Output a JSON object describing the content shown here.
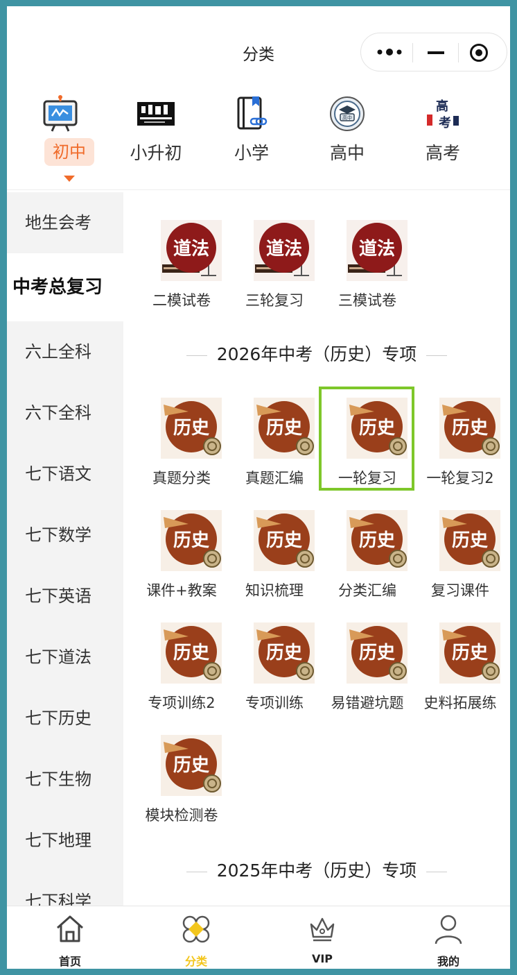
{
  "header": {
    "title": "分类"
  },
  "capsule": {
    "more": "more-dots-icon",
    "minimize": "minimize-icon",
    "close": "target-icon"
  },
  "top_categories": [
    {
      "label": "初中",
      "active": true,
      "icon": "board-icon"
    },
    {
      "label": "小升初",
      "active": false,
      "icon": "classroom-icon"
    },
    {
      "label": "小学",
      "active": false,
      "icon": "book-link-icon"
    },
    {
      "label": "高中",
      "active": false,
      "icon": "graduation-badge-icon"
    },
    {
      "label": "高考",
      "active": false,
      "icon": "gaokao-icon"
    }
  ],
  "sidebar": {
    "items": [
      "地生会考",
      "中考总复习",
      "六上全科",
      "六下全科",
      "七下语文",
      "七下数学",
      "七下英语",
      "七下道法",
      "七下历史",
      "七下生物",
      "七下地理",
      "七下科学"
    ],
    "active_index": 1
  },
  "sections": {
    "daofa": {
      "icon_text": "道法",
      "items": [
        "二模试卷",
        "三轮复习",
        "三模试卷"
      ]
    },
    "history_2026": {
      "title": "2026年中考（历史）专项",
      "icon_text": "历史",
      "items": [
        "真题分类",
        "真题汇编",
        "一轮复习",
        "一轮复习2",
        "课件+教案",
        "知识梳理",
        "分类汇编",
        "复习课件",
        "专项训练2",
        "专项训练",
        "易错避坑题",
        "史料拓展练",
        "模块检测卷"
      ],
      "selected_index": 2
    },
    "history_2025": {
      "title": "2025年中考（历史）专项"
    }
  },
  "tabbar": {
    "items": [
      {
        "label": "首页",
        "icon": "home-icon",
        "active": false
      },
      {
        "label": "分类",
        "icon": "category-icon",
        "active": true
      },
      {
        "label": "VIP",
        "icon": "crown-icon",
        "active": false
      },
      {
        "label": "我的",
        "icon": "user-icon",
        "active": false
      }
    ]
  },
  "colors": {
    "accent": "#f06b2a",
    "selection": "#7ec72a",
    "tab_active": "#f3c61d",
    "daofa_icon": "#8e1a1a",
    "history_icon": "#9a3f1b"
  }
}
